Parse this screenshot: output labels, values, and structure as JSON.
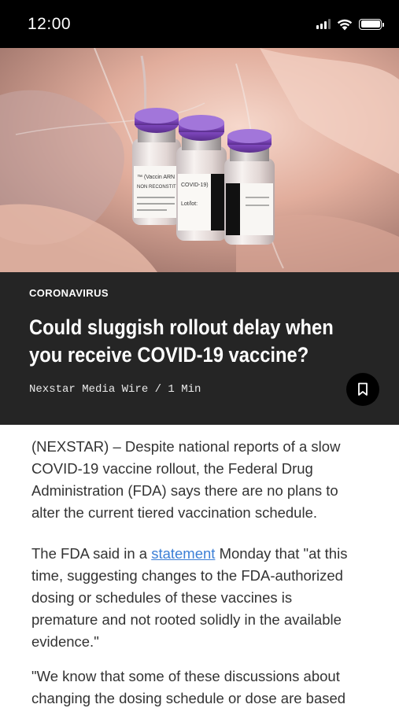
{
  "status_bar": {
    "time": "12:00",
    "icons": [
      "signal-icon",
      "wifi-icon",
      "battery-icon"
    ]
  },
  "hero": {
    "image": "vaccine-vials-photo",
    "vial_labels": [
      "™ (Vaccin ARN",
      "NON RECONSTIT",
      "COVID-19)",
      "Lot/lot:"
    ]
  },
  "article": {
    "category": "CORONAVIRUS",
    "headline_lines": [
      "Could sluggish rollout delay when",
      "you receive COVID-19 vaccine?"
    ],
    "byline": "Nexstar Media Wire / 1 Min",
    "bookmark_icon": "bookmark-icon",
    "paragraph_1": [
      "(NEXSTAR) – Despite national reports of a slow",
      "COVID-19 vaccine rollout, the Federal Drug",
      "Administration (FDA) says there are no plans to",
      "alter the current tiered vaccination schedule."
    ],
    "paragraph_2": {
      "line_1_before": "The FDA said in a ",
      "line_1_link": "statement",
      "line_1_after": " Monday that \"at this",
      "lines": [
        "time, suggesting changes to the FDA-authorized",
        "dosing or schedules of these vaccines is",
        "premature and not rooted solidly in the available",
        "evidence.\""
      ]
    },
    "paragraph_3": [
      "\"We know that some of these discussions about",
      "changing the dosing schedule or dose are based"
    ]
  },
  "colors": {
    "status_bar_bg": "#000000",
    "headline_bg": "#252525",
    "link": "#3b7fd6",
    "body_text": "#333333",
    "vial_cap": "#7a44b8"
  }
}
